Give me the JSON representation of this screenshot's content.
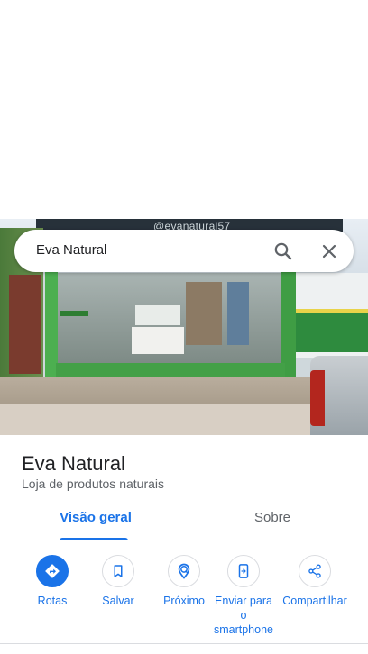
{
  "photo": {
    "sign_text": "@evanatural57"
  },
  "search": {
    "query": "Eva Natural"
  },
  "place": {
    "name": "Eva Natural",
    "category": "Loja de produtos naturais"
  },
  "tabs": [
    {
      "label": "Visão geral",
      "selected": true
    },
    {
      "label": "Sobre",
      "selected": false
    }
  ],
  "actions": [
    {
      "label": "Rotas",
      "icon": "directions-icon"
    },
    {
      "label": "Salvar",
      "icon": "bookmark-icon"
    },
    {
      "label": "Próximo",
      "icon": "nearby-icon"
    },
    {
      "label": "Enviar para o smartphone",
      "icon": "send-to-phone-icon"
    },
    {
      "label": "Compartilhar",
      "icon": "share-icon"
    }
  ],
  "colors": {
    "accent": "#1a73e8",
    "text_primary": "#202124",
    "text_secondary": "#5f6368",
    "divider": "#dadce0"
  }
}
